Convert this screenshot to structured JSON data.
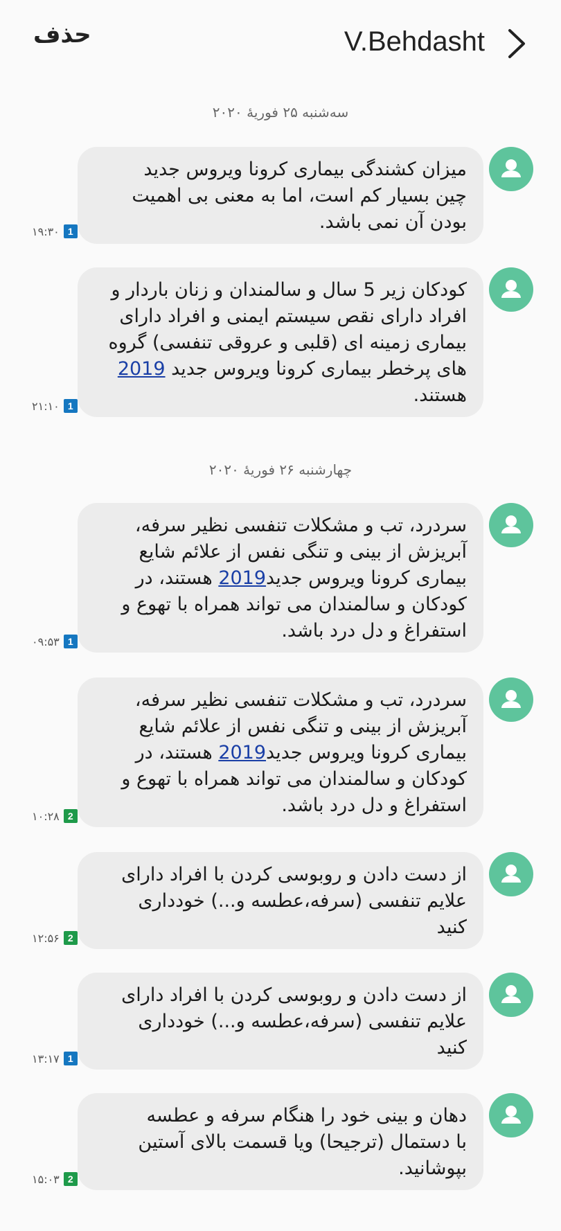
{
  "header": {
    "delete_label": "حذف",
    "contact_name": "V.Behdasht"
  },
  "date_separators": [
    "سه‌شنبه ۲۵ فوریهٔ ۲۰۲۰",
    "چهارشنبه ۲۶ فوریهٔ ۲۰۲۰"
  ],
  "messages": [
    {
      "text": "میزان کشندگی بیماری کرونا ویروس جدید\nچین بسیار کم است، اما به معنی بی اهمیت\nبودن آن نمی باشد.",
      "time": "۱۹:۳۰",
      "sim": "1"
    },
    {
      "text_before": "کودکان زیر 5 سال و سالمندان و زنان باردار و\nافراد دارای نقص سیستم ایمنی و افراد دارای\nبیماری زمینه ای (قلبی و عروقی تنفسی) گروه\nهای پرخطر بیماری کرونا ویروس جدید ",
      "link": "2019",
      "text_after": "\nهستند.",
      "time": "۲۱:۱۰",
      "sim": "1"
    },
    {
      "text_before": "سردرد، تب و مشکلات تنفسی نظیر سرفه،\nآبریزش از بینی و تنگی نفس از علائم شایع\nبیماری کرونا ویروس جدید",
      "link": "2019",
      "text_after": " هستند، در\nکودکان و سالمندان می تواند همراه با تهوع و\nاستفراغ و دل درد باشد.",
      "time": "۰۹:۵۳",
      "sim": "1"
    },
    {
      "text_before": "سردرد، تب و مشکلات تنفسی نظیر سرفه،\nآبریزش از بینی و تنگی نفس از علائم شایع\nبیماری کرونا ویروس جدید",
      "link": "2019",
      "text_after": " هستند، در\nکودکان و سالمندان می تواند همراه با تهوع و\nاستفراغ و دل درد باشد.",
      "time": "۱۰:۲۸",
      "sim": "2"
    },
    {
      "text": "از دست دادن و روبوسی کردن با افراد دارای\nعلایم تنفسی (سرفه،عطسه و...) خودداری\nکنید",
      "time": "۱۲:۵۶",
      "sim": "2"
    },
    {
      "text": "از دست دادن و روبوسی کردن با افراد دارای\nعلایم تنفسی (سرفه،عطسه و...) خودداری\nکنید",
      "time": "۱۳:۱۷",
      "sim": "1"
    },
    {
      "text": "دهان و بینی خود را هنگام سرفه و عطسه\nبا دستمال (ترجیحا) ویا قسمت بالای آستین\nبپوشانید.",
      "time": "۱۵:۰۳",
      "sim": "2"
    }
  ],
  "colors": {
    "avatar": "#5ec49c",
    "bubble": "#ececec",
    "link": "#1a3fa6",
    "sim1": "#1577c0",
    "sim2": "#1e9a4a"
  },
  "icons": {
    "back": "chevron-right-icon",
    "avatar": "person-icon"
  }
}
